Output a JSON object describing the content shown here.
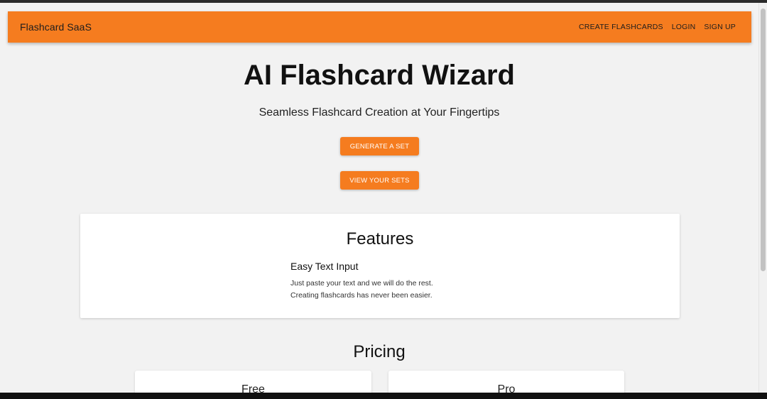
{
  "appbar": {
    "brand": "Flashcard SaaS",
    "nav": [
      "CREATE FLASHCARDS",
      "LOGIN",
      "SIGN UP"
    ]
  },
  "hero": {
    "title": "AI Flashcard Wizard",
    "subtitle": "Seamless Flashcard Creation at Your Fingertips",
    "generate_label": "GENERATE A SET",
    "view_label": "VIEW YOUR SETS"
  },
  "features": {
    "title": "Features",
    "items": [
      {
        "title": "Easy Text Input",
        "line1": "Just paste your text and we will do the rest.",
        "line2": "Creating flashcards has never been easier."
      }
    ]
  },
  "pricing": {
    "title": "Pricing",
    "plans": [
      {
        "name": "Free"
      },
      {
        "name": "Pro"
      }
    ]
  },
  "colors": {
    "accent": "#f57c1f",
    "background": "#f2f2f2"
  }
}
